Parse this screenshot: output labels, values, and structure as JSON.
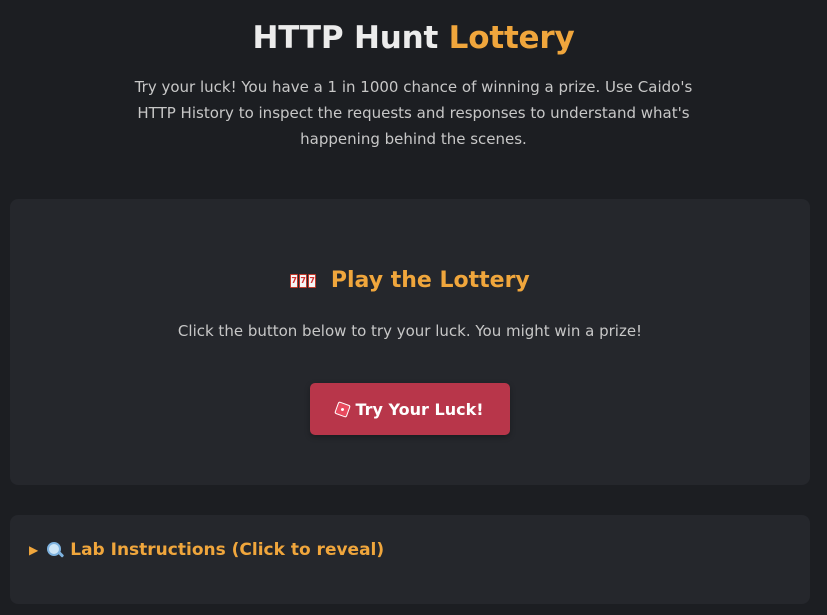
{
  "header": {
    "title_main": "HTTP Hunt",
    "title_accent": "Lottery",
    "description": "Try your luck! You have a 1 in 1000 chance of winning a prize. Use Caido's HTTP History to inspect the requests and responses to understand what's happening behind the scenes."
  },
  "lottery": {
    "heading": "Play the Lottery",
    "icon": "slot-machine-icon",
    "slot_glyphs": [
      "7",
      "7",
      "7"
    ],
    "description": "Click the button below to try your luck. You might win a prize!",
    "button_label": "Try Your Luck!",
    "button_icon": "die-icon"
  },
  "instructions": {
    "summary_label": "Lab Instructions (Click to reveal)",
    "toggle_icon": "triangle-right-icon",
    "icon": "magnifier-icon"
  },
  "colors": {
    "background": "#1c1e22",
    "card": "#25272c",
    "accent": "#f0a63c",
    "button": "#b8364a",
    "text": "#c7c7c7"
  }
}
